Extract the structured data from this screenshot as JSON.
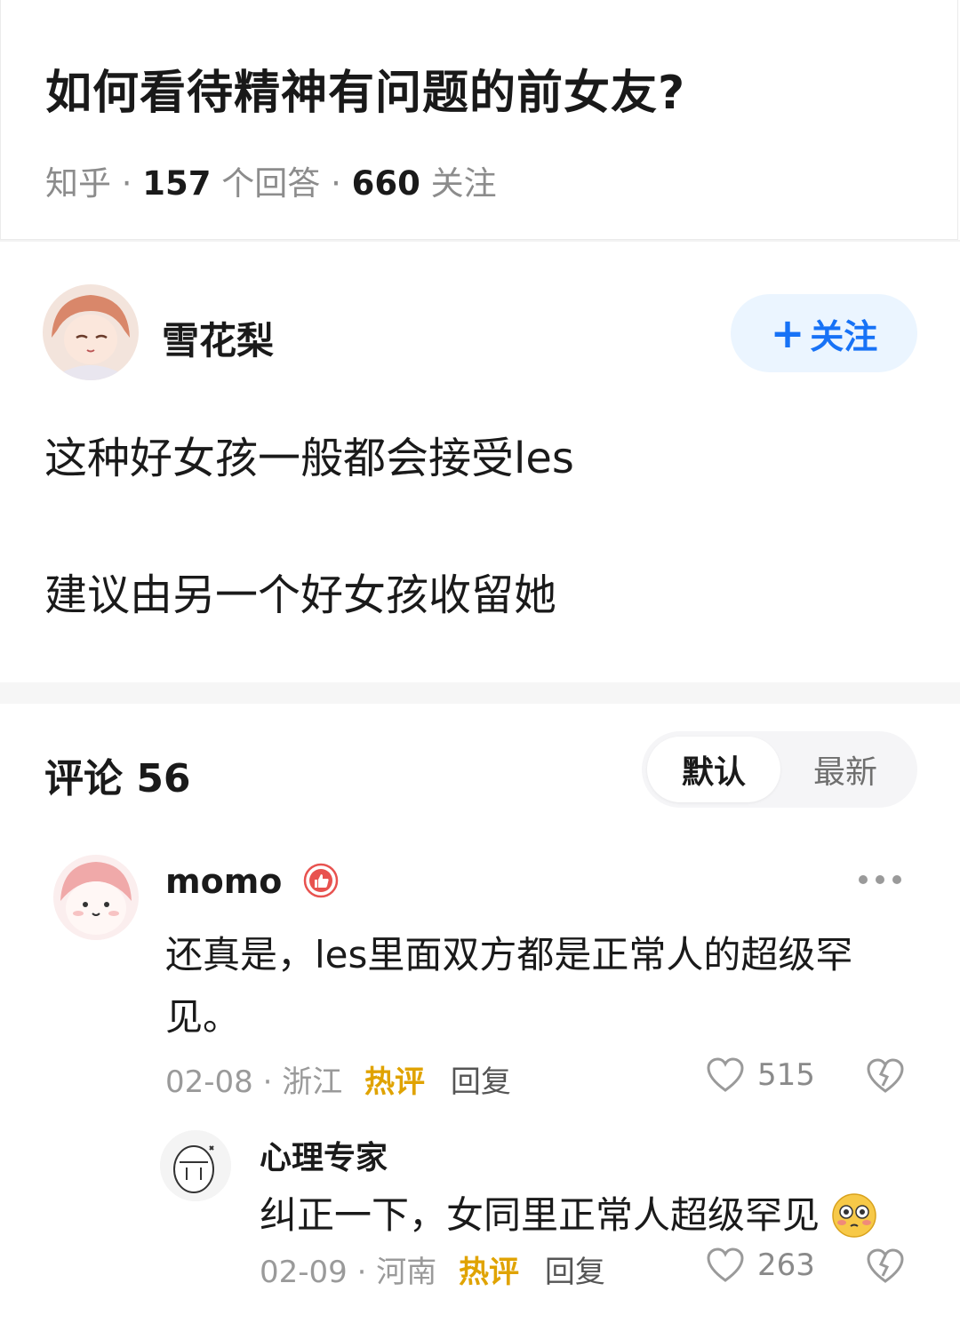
{
  "question": {
    "title": "如何看待精神有问题的前女友?",
    "source": "知乎",
    "answers_count": "157",
    "answers_label": "个回答",
    "followers_count": "660",
    "followers_label": "关注",
    "sep": "·"
  },
  "answer": {
    "author": "雪花梨",
    "follow_label": "关注",
    "lines": [
      "这种好女孩一般都会接受les",
      "建议由另一个好女孩收留她"
    ]
  },
  "comments_header": {
    "title": "评论 56",
    "sort_default": "默认",
    "sort_newest": "最新"
  },
  "comments": [
    {
      "name": "momo",
      "text": "还真是，les里面双方都是正常人的超级罕见。",
      "date": "02-08",
      "location": "浙江",
      "hot": "热评",
      "reply": "回复",
      "likes": "515"
    },
    {
      "name": "心理专家",
      "text": "纠正一下，女同里正常人超级罕见",
      "date": "02-09",
      "location": "河南",
      "hot": "热评",
      "reply": "回复",
      "likes": "263"
    }
  ],
  "colors": {
    "accent": "#1772f6",
    "hot": "#e0a300",
    "muted": "#9a9a9a"
  }
}
